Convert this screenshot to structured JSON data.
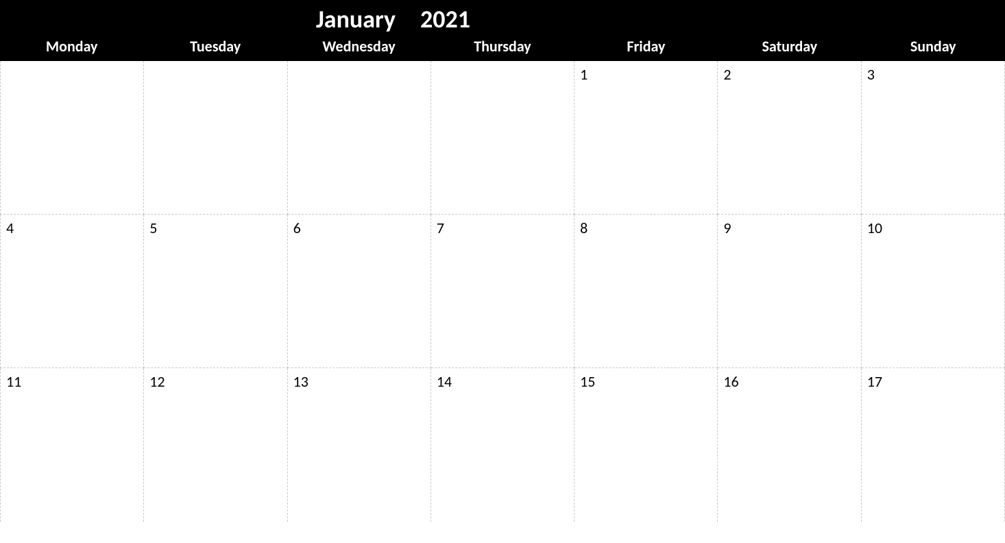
{
  "calendar": {
    "month": "January",
    "year": "2021",
    "weekdays": [
      "Monday",
      "Tuesday",
      "Wednesday",
      "Thursday",
      "Friday",
      "Saturday",
      "Sunday"
    ],
    "weeks": [
      [
        "",
        "",
        "",
        "",
        "1",
        "2",
        "3"
      ],
      [
        "4",
        "5",
        "6",
        "7",
        "8",
        "9",
        "10"
      ],
      [
        "11",
        "12",
        "13",
        "14",
        "15",
        "16",
        "17"
      ]
    ]
  }
}
